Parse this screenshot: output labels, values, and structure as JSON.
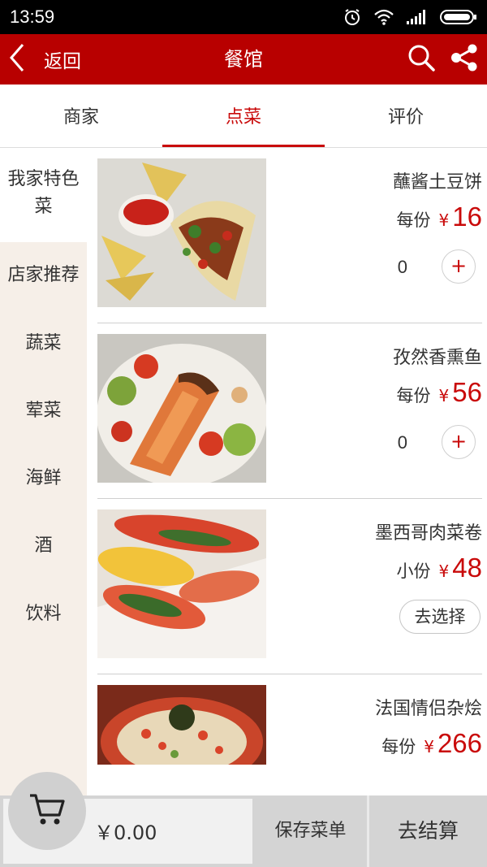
{
  "status_bar": {
    "time": "13:59"
  },
  "app_bar": {
    "back_label": "返回",
    "title": "餐馆"
  },
  "tabs": [
    {
      "label": "商家"
    },
    {
      "label": "点菜",
      "active": true
    },
    {
      "label": "评价"
    }
  ],
  "categories": [
    {
      "label": "我家特色菜",
      "active": true
    },
    {
      "label": "店家推荐"
    },
    {
      "label": "蔬菜"
    },
    {
      "label": "荤菜"
    },
    {
      "label": "海鲜"
    },
    {
      "label": "酒"
    },
    {
      "label": "饮料"
    }
  ],
  "dishes": [
    {
      "name": "蘸酱土豆饼",
      "unit": "每份",
      "currency": "¥",
      "price": "16",
      "quantity": "0",
      "action": "plus"
    },
    {
      "name": "孜然香熏鱼",
      "unit": "每份",
      "currency": "¥",
      "price": "56",
      "quantity": "0",
      "action": "plus"
    },
    {
      "name": "墨西哥肉菜卷",
      "unit": "小份",
      "currency": "¥",
      "price": "48",
      "choose_label": "去选择",
      "action": "choose"
    },
    {
      "name": "法国情侣杂烩",
      "unit": "每份",
      "currency": "¥",
      "price": "266"
    }
  ],
  "bottom_bar": {
    "total": "￥0.00",
    "save_label": "保存菜单",
    "checkout_label": "去结算"
  },
  "plus_symbol": "+",
  "colors": {
    "brand_red": "#b80000",
    "price_red": "#c90a0a",
    "sidebar_bg": "#f6efe8"
  },
  "icons": [
    "alarm-icon",
    "wifi-icon",
    "signal-icon",
    "battery-icon",
    "back-chevron-icon",
    "search-icon",
    "share-icon",
    "cart-icon"
  ]
}
